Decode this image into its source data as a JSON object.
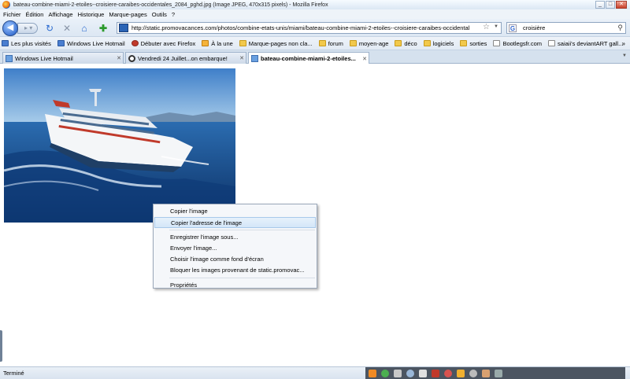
{
  "window": {
    "title": "bateau-combine-miami-2-etoiles--croisiere-caraibes-occidentales_2084_pghd.jpg (Image JPEG, 470x315 pixels) - Mozilla Firefox",
    "controls": [
      "_",
      "□",
      "✕"
    ]
  },
  "menubar": {
    "items": [
      "Fichier",
      "Édition",
      "Affichage",
      "Historique",
      "Marque-pages",
      "Outils",
      "?"
    ]
  },
  "navigation": {
    "back_icon": "back-arrow-icon",
    "forward_icon": "forward-arrow-icon",
    "reload_icon": "reload-icon",
    "stop_icon": "stop-icon",
    "home_icon": "home-icon",
    "addon_icon": "add-icon",
    "url": "http://static.promovacances.com/photos/combine-etats-unis/miami/bateau-combine-miami-2-etoiles--croisiere-caraibes-occidental",
    "search_engine": "G",
    "search_value": "croisière"
  },
  "bookmarks": [
    {
      "label": "Les plus visités",
      "icon": "blue"
    },
    {
      "label": "Windows Live Hotmail",
      "icon": "blue"
    },
    {
      "label": "Débuter avec Firefox",
      "icon": "red"
    },
    {
      "label": "À la une",
      "icon": "star"
    },
    {
      "label": "Marque-pages non cla...",
      "icon": "folder"
    },
    {
      "label": "forum",
      "icon": "folder"
    },
    {
      "label": "moyen-age",
      "icon": "folder"
    },
    {
      "label": "déco",
      "icon": "folder"
    },
    {
      "label": "logiciels",
      "icon": "folder"
    },
    {
      "label": "sorties",
      "icon": "folder"
    },
    {
      "label": "Bootlegsfr.com",
      "icon": "page"
    },
    {
      "label": "saiaii's deviantART gall...",
      "icon": "page"
    }
  ],
  "bookmarks_more": "»",
  "tabs": [
    {
      "label": "Windows Live Hotmail",
      "active": false
    },
    {
      "label": "Vendredi 24 Juillet...on embarque!",
      "active": false
    },
    {
      "label": "bateau-combine-miami-2-etoiles...",
      "active": true
    }
  ],
  "context_menu": {
    "items": [
      {
        "label": "Copier l'image",
        "highlight": false
      },
      {
        "label": "Copier l'adresse de l'image",
        "highlight": true
      },
      {
        "separator": true
      },
      {
        "label": "Enregistrer l'image sous...",
        "highlight": false
      },
      {
        "label": "Envoyer l'image...",
        "highlight": false
      },
      {
        "label": "Choisir l'image comme fond d'écran",
        "highlight": false
      },
      {
        "label": "Bloquer les images provenant de static.promovac...",
        "highlight": false
      },
      {
        "separator": true
      },
      {
        "label": "Propriétés",
        "highlight": false
      }
    ]
  },
  "status": {
    "text": "Terminé"
  },
  "colors": {
    "chrome": "#dce7f3",
    "highlight": "#d4e6f8",
    "tray": "#4c5561"
  }
}
